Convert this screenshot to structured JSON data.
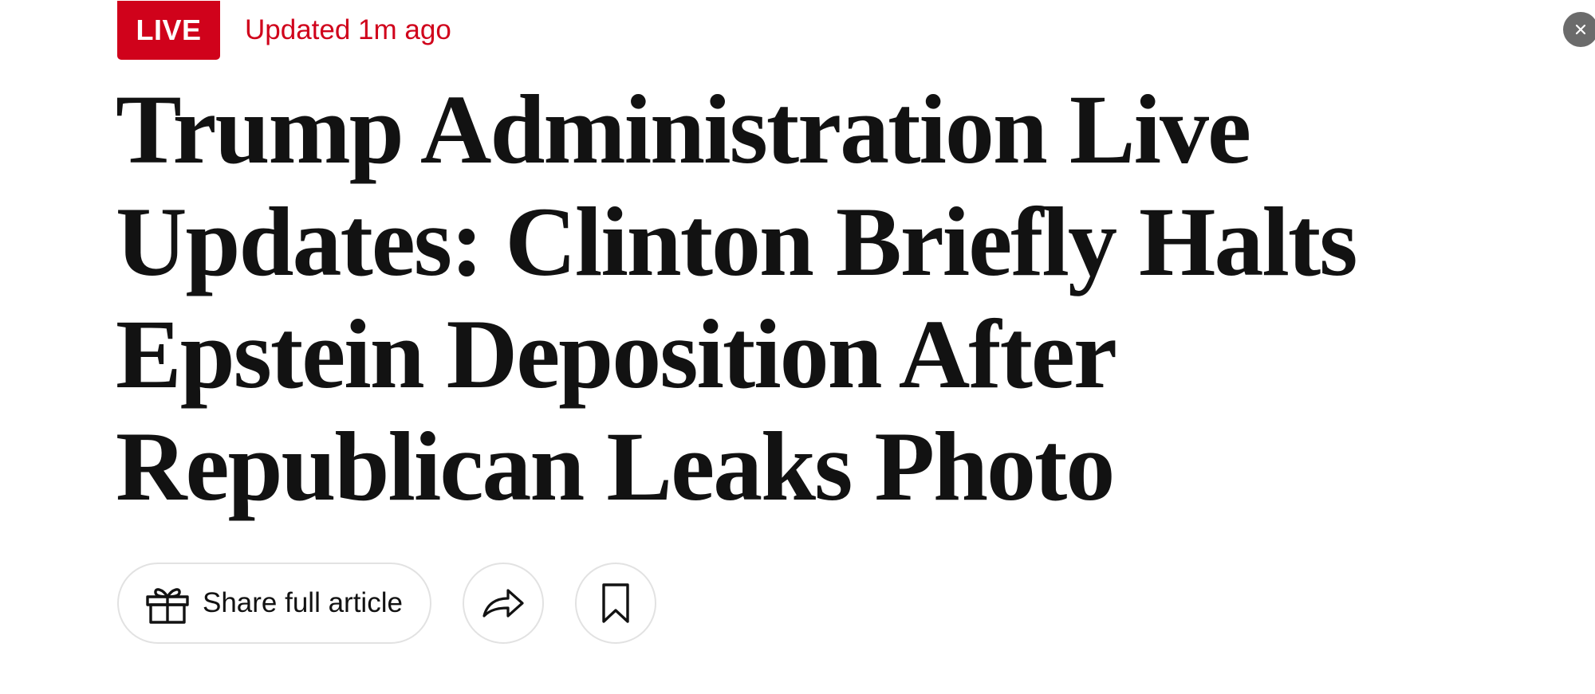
{
  "live_badge": {
    "label": "LIVE",
    "color": "#d0021b"
  },
  "updated_text": "Updated 1m ago",
  "headline": "Trump Administration Live Updates: Clinton Briefly Halts Epstein Deposition After Republican Leaks Photo",
  "actions": {
    "share_full_article_label": "Share full article",
    "share_full_article_icon": "gift-icon",
    "share_icon": "share-arrow-icon",
    "save_icon": "bookmark-icon"
  },
  "close_icon": "close-icon"
}
